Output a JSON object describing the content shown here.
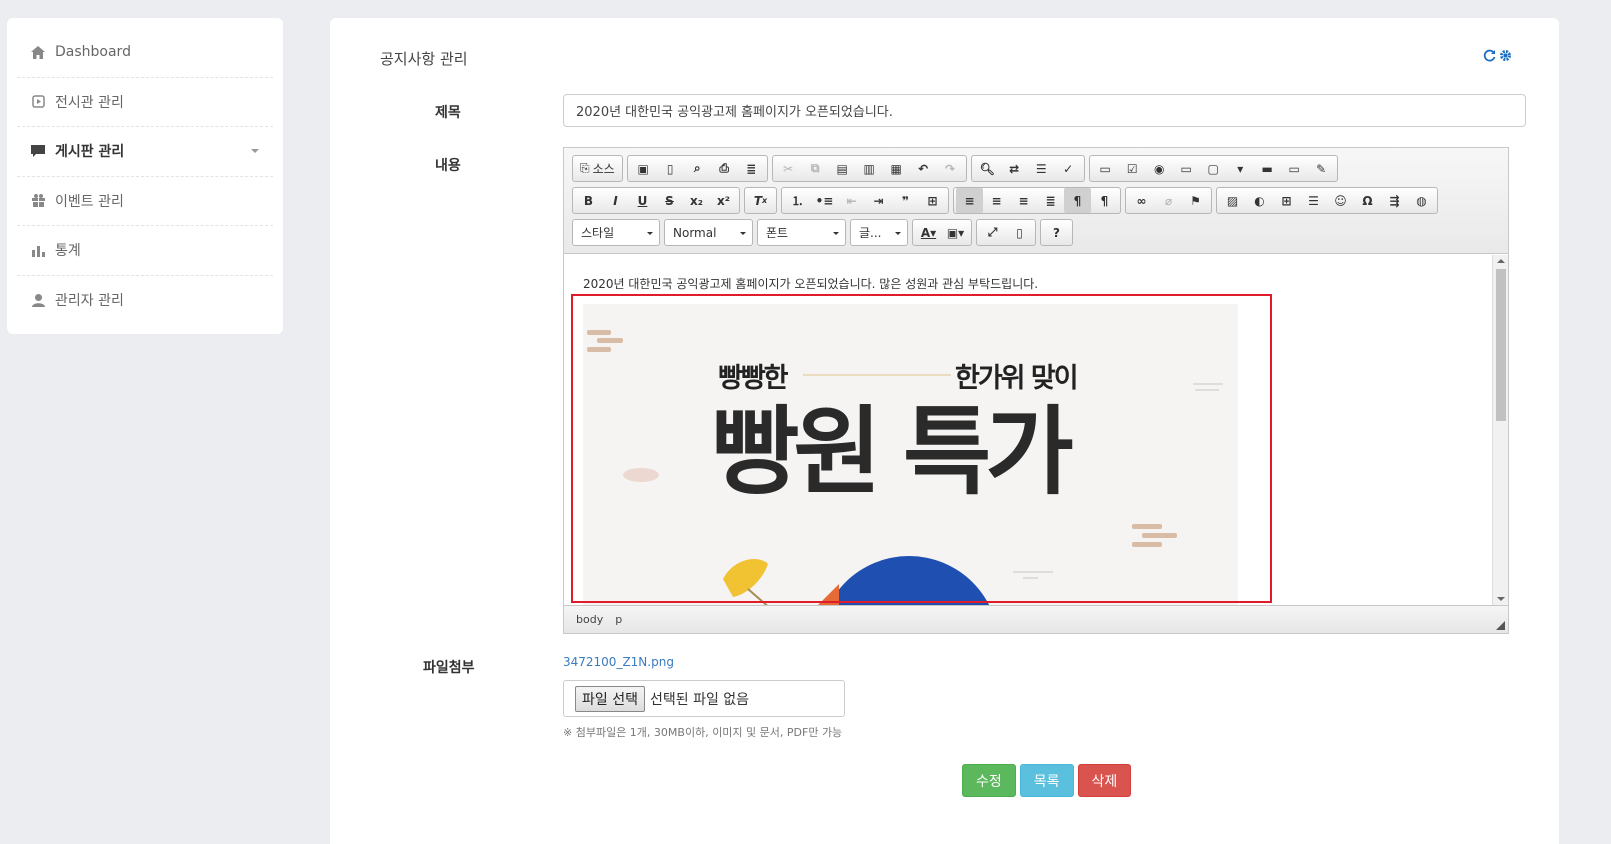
{
  "sidebar": {
    "items": [
      {
        "label": "Dashboard",
        "icon": "home-icon"
      },
      {
        "label": "전시관 관리",
        "icon": "play-circle-icon"
      },
      {
        "label": "게시판 관리",
        "icon": "comment-icon"
      },
      {
        "label": "이벤트 관리",
        "icon": "gift-icon"
      },
      {
        "label": "통계",
        "icon": "bar-chart-icon"
      },
      {
        "label": "관리자 관리",
        "icon": "user-icon"
      }
    ]
  },
  "main": {
    "page_title": "공지사항 관리",
    "labels": {
      "title": "제목",
      "content": "내용",
      "attachment": "파일첨부"
    },
    "title_value": "2020년 대한민국 공익광고제 홈페이지가 오픈되었습니다.",
    "editor": {
      "source_label": "소스",
      "style_combo": "스타일",
      "format_combo": "Normal",
      "font_combo": "폰트",
      "size_combo": "글...",
      "help_label": "?",
      "body_text": "2020년 대한민국 공익광고제 홈페이지가 오픈되었습니다. 많은 성원과 관심 부탁드립니다.",
      "banner_text_left": "빵빵한",
      "banner_text_right": "한가위 맞이",
      "banner_text_main": "빵원 특가",
      "status_path": [
        "body",
        "p"
      ]
    },
    "attachment": {
      "file_link": "3472100_Z1N.png",
      "choose_button": "파일 선택",
      "no_file_text": "선택된 파일 없음",
      "note": "※ 첨부파일은 1개, 30MB이하, 이미지 및 문서, PDF만 가능"
    },
    "buttons": {
      "edit": "수정",
      "list": "목록",
      "delete": "삭제"
    },
    "colors": {
      "edit": "#5cb85c",
      "list": "#5bc0de",
      "delete": "#d9534f",
      "selection": "#e21b2b"
    }
  }
}
